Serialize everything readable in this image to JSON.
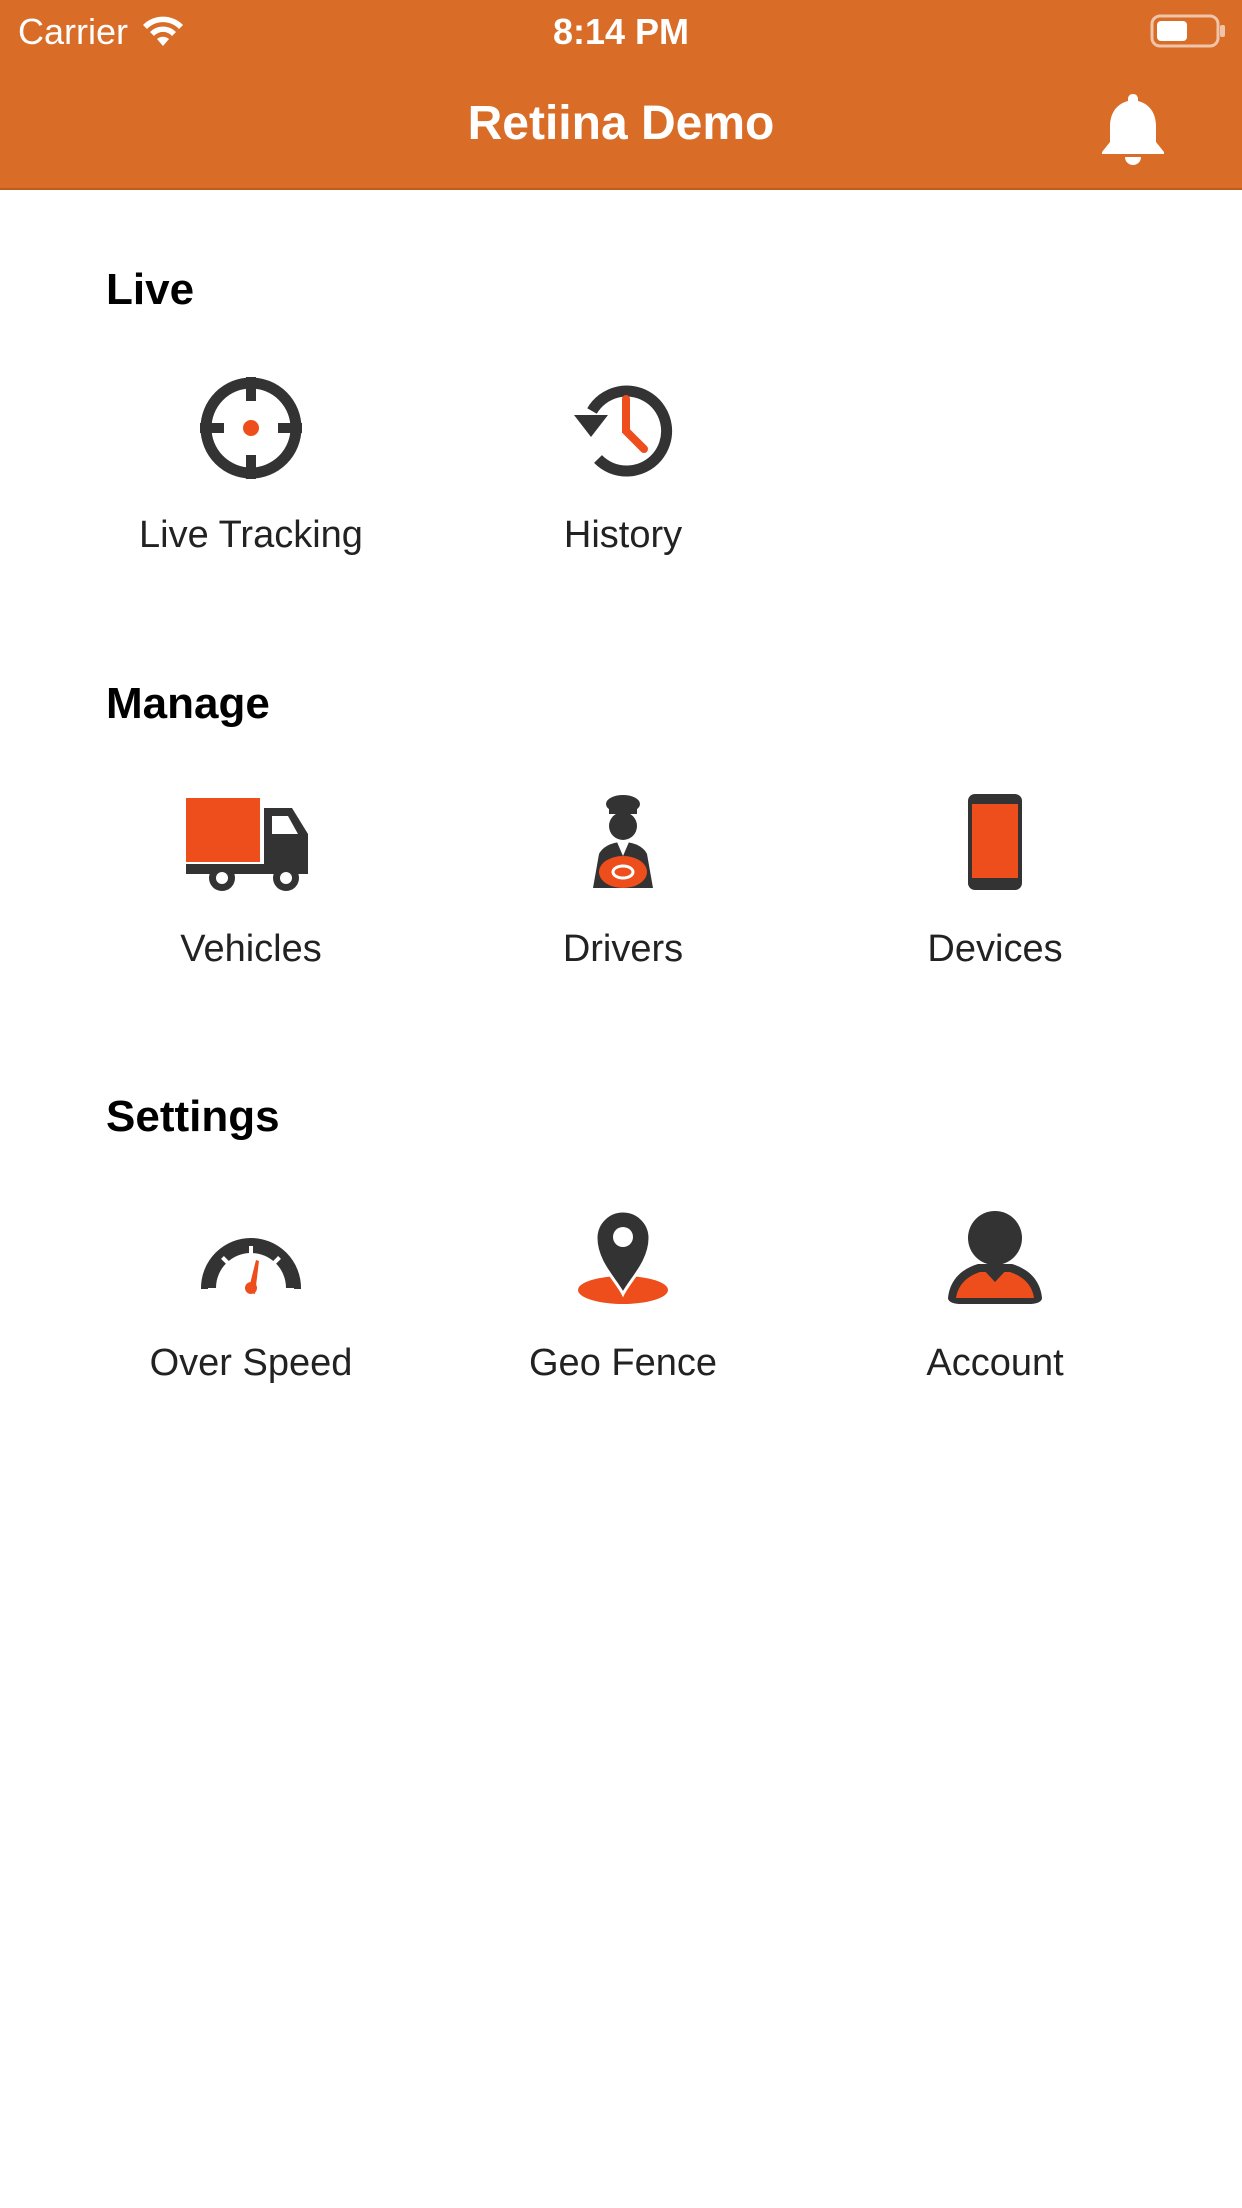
{
  "status_bar": {
    "carrier": "Carrier",
    "time": "8:14 PM"
  },
  "header": {
    "title": "Retiina Demo",
    "bell_icon": "bell-icon"
  },
  "colors": {
    "header_bg": "#d96c27",
    "accent": "#ee4d1c",
    "icon_dark": "#333333"
  },
  "sections": [
    {
      "title": "Live",
      "items": [
        {
          "label": "Live Tracking",
          "icon": "crosshair-icon"
        },
        {
          "label": "History",
          "icon": "history-icon"
        }
      ]
    },
    {
      "title": "Manage",
      "items": [
        {
          "label": "Vehicles",
          "icon": "truck-icon"
        },
        {
          "label": "Drivers",
          "icon": "driver-icon"
        },
        {
          "label": "Devices",
          "icon": "phone-icon"
        }
      ]
    },
    {
      "title": "Settings",
      "items": [
        {
          "label": "Over Speed",
          "icon": "speedometer-icon"
        },
        {
          "label": "Geo Fence",
          "icon": "location-pin-icon"
        },
        {
          "label": "Account",
          "icon": "user-icon"
        }
      ]
    }
  ]
}
